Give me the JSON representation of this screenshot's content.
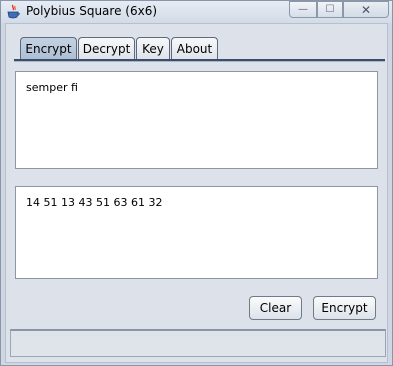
{
  "window": {
    "title": "Polybius Square (6x6)",
    "controls": {
      "minimize": "—",
      "maximize": "☐",
      "close": "✕"
    }
  },
  "tabs": [
    {
      "label": "Encrypt",
      "active": true
    },
    {
      "label": "Decrypt",
      "active": false
    },
    {
      "label": "Key",
      "active": false
    },
    {
      "label": "About",
      "active": false
    }
  ],
  "input": {
    "value": "semper fi"
  },
  "output": {
    "value": "14 51 13 43 51 63 61 32"
  },
  "buttons": {
    "clear": "Clear",
    "encrypt": "Encrypt"
  },
  "status": {
    "text": ""
  },
  "colors": {
    "accent": "#3a4d6b",
    "active_tab": "#b9c9dc"
  },
  "icons": {
    "app": "java-coffee-icon"
  }
}
